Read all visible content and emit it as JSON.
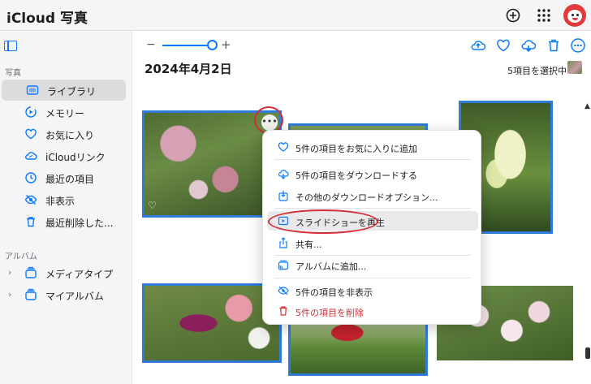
{
  "app": {
    "apple_glyph": "",
    "title": "iCloud 写真"
  },
  "topbar": {
    "icons": [
      "add-icon",
      "app-grid-icon"
    ],
    "avatar": "user-avatar"
  },
  "sidebar": {
    "photos_section": "写真",
    "items": [
      {
        "label": "ライブラリ",
        "icon": "library-icon",
        "selected": true
      },
      {
        "label": "メモリー",
        "icon": "memories-icon"
      },
      {
        "label": "お気に入り",
        "icon": "heart-icon"
      },
      {
        "label": "iCloudリンク",
        "icon": "icloud-link-icon"
      },
      {
        "label": "最近の項目",
        "icon": "clock-icon"
      },
      {
        "label": "非表示",
        "icon": "eye-slash-icon"
      },
      {
        "label": "最近削除した...",
        "icon": "trash-icon"
      }
    ],
    "albums_section": "アルバム",
    "albums": [
      {
        "label": "メディアタイプ",
        "icon": "album-stack-icon"
      },
      {
        "label": "マイアルバム",
        "icon": "album-stack-icon"
      }
    ]
  },
  "toolbar": {
    "zoom_minus": "−",
    "zoom_plus": "+",
    "zoom_level": 0.85,
    "icons": [
      "upload-icon",
      "heart-icon",
      "download-icon",
      "trash-icon",
      "more-icon"
    ]
  },
  "main": {
    "date_title": "2024年4月2日",
    "selection_count": "5項目を選択中"
  },
  "context_menu": {
    "items": [
      {
        "label": "5件の項目をお気に入りに追加",
        "icon": "heart-icon"
      },
      {
        "label": "5件の項目をダウンロードする",
        "icon": "download-icon"
      },
      {
        "label": "その他のダウンロードオプション...",
        "icon": "download-options-icon"
      },
      {
        "label": "スライドショーを再生",
        "icon": "slideshow-play-icon",
        "highlighted": true
      },
      {
        "label": "共有...",
        "icon": "share-icon"
      },
      {
        "label": "アルバムに追加...",
        "icon": "add-to-album-icon"
      },
      {
        "label": "5件の項目を非表示",
        "icon": "eye-slash-icon"
      },
      {
        "label": "5件の項目を削除",
        "icon": "trash-icon",
        "destructive": true
      }
    ]
  },
  "colors": {
    "accent": "#0a7aff",
    "destructive": "#d42d36",
    "annotation": "#d42d36"
  },
  "more_button": "•••"
}
